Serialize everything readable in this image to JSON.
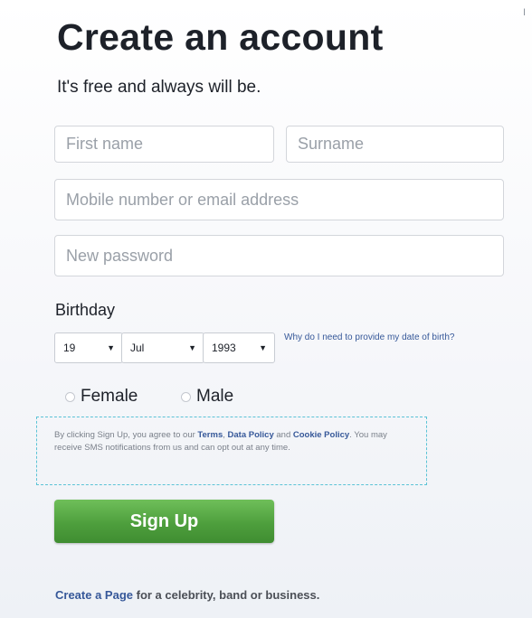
{
  "header": {
    "title": "Create an account",
    "subtitle": "It's free and always will be.",
    "corner_mark": "I"
  },
  "form": {
    "first_name_placeholder": "First name",
    "surname_placeholder": "Surname",
    "contact_placeholder": "Mobile number or email address",
    "password_placeholder": "New password",
    "birthday_label": "Birthday",
    "day_value": "19",
    "month_value": "Jul",
    "year_value": "1993",
    "why_link": "Why do I need to provide my date of birth?",
    "gender_female": "Female",
    "gender_male": "Male"
  },
  "terms": {
    "text_1": "By clicking Sign Up, you agree to our ",
    "terms_link": "Terms",
    "sep": ", ",
    "data_policy_link": "Data Policy",
    "and": " and ",
    "cookie_policy_link": "Cookie Policy",
    "text_2": ". You may receive SMS notifications from us and can opt out at any time."
  },
  "actions": {
    "signup_label": "Sign Up"
  },
  "footer": {
    "create_page_link": "Create a Page",
    "create_page_text": " for a celebrity, band or business."
  },
  "colors": {
    "link": "#365899",
    "signup_green": "#4e9f3d",
    "dashed_border": "#5bc3d6"
  }
}
